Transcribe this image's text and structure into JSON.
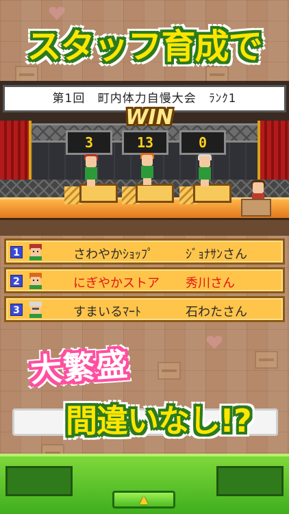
{
  "headline": "スタッフ育成で",
  "contest": {
    "round": "第1回",
    "name": "町内体力自慢大会",
    "rank": "ﾗﾝｸ1"
  },
  "result_banner": "WIN",
  "scores": [
    "3",
    "13",
    "0"
  ],
  "ranking": [
    {
      "place": "1",
      "shop": "さわやかｼｮｯﾌﾟ",
      "person": "ｼﾞｮﾅｻﾝさん",
      "highlight": false
    },
    {
      "place": "2",
      "shop": "にぎやかストア",
      "person": "秀川さん",
      "highlight": true
    },
    {
      "place": "3",
      "shop": "すまいるﾏｰﾄ",
      "person": "石わたさん",
      "highlight": false
    }
  ],
  "promo_line1": "大繁盛",
  "promo_line2": "間違いなし!?",
  "expand_icon": "▲",
  "colors": {
    "headline": "#ffe600",
    "headline_outline": "#2b7a1e",
    "promo_pink": "#ff4fa0",
    "rank_row": "#ffc44a",
    "highlight_text": "#e01616",
    "score_digits": "#ffd21a",
    "bottom_bar": "#5cc42a"
  }
}
